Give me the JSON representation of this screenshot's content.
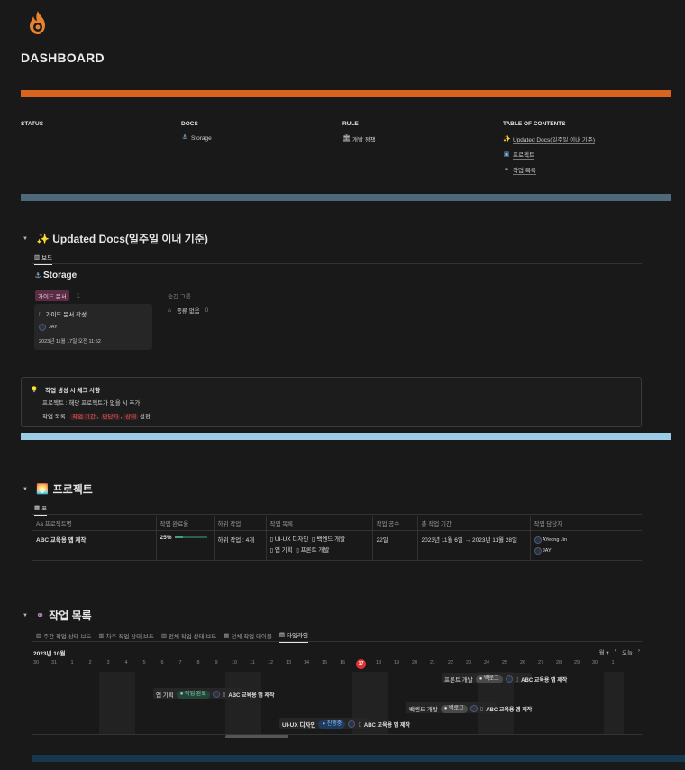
{
  "page": {
    "title": "DASHBOARD",
    "icon": "fire-icon"
  },
  "columns": {
    "status": {
      "heading": "STATUS"
    },
    "docs": {
      "heading": "DOCS",
      "items": [
        {
          "icon": "anchor-icon",
          "label": "Storage"
        }
      ]
    },
    "rule": {
      "heading": "RULE",
      "items": [
        {
          "icon": "building-icon",
          "label": "개발 정책"
        }
      ]
    },
    "toc": {
      "heading": "TABLE OF CONTENTS",
      "items": [
        {
          "icon": "sparkles-icon",
          "label": "Updated Docs(일주일 이내 기준)"
        },
        {
          "icon": "book-icon",
          "label": "프로젝트"
        },
        {
          "icon": "link-icon",
          "label": "작업 목록"
        }
      ]
    }
  },
  "updated_docs": {
    "title": "✨ Updated Docs(일주일 이내 기준)",
    "tab": "보드",
    "board_title": "Storage",
    "group_tag": "가이드 문서",
    "group_count": "1",
    "hidden_groups_label": "숨긴 그룹",
    "no_type_label": "종류 없음",
    "no_type_count": "0",
    "card": {
      "title": "가이드 문서 작성",
      "author": "JAY",
      "date": "2023년 11월 17일 오전 11:52"
    }
  },
  "callout": {
    "title": "작업 생성 시 체크 사항",
    "line1": "프로젝트 : 해당 프로젝트가 없을 시 추가",
    "line2_prefix": "작업 목록 : ",
    "tags": [
      "작업 기간",
      "담당자",
      "상태"
    ],
    "line2_suffix": " 설정"
  },
  "projects": {
    "title": "프로젝트",
    "tab": "표",
    "headers": [
      "Aa 프로젝트명",
      "작업 완료율",
      "하위 작업",
      "작업 목록",
      "작업 공수",
      "총 작업 기간",
      "작업 담당자"
    ],
    "row": {
      "name": "ABC 교육용 앱 제작",
      "progress_label": "25%",
      "progress": 0.25,
      "subtasks": "하위 작업 : 4개",
      "tasks": [
        "UI-UX 디자인",
        "백엔드 개발",
        "앱 기획",
        "프론트 개발"
      ],
      "effort": "22일",
      "period": "2023년 11월 6일 → 2023년 11월 28일",
      "assignees": [
        "AYeong Jin",
        "JAY"
      ]
    }
  },
  "tasks": {
    "title": "작업 목록",
    "tabs": [
      "주간 작업 상태 보드",
      "차주 작업 상태 보드",
      "전체 작업 상태 보드",
      "전체 작업 테이블",
      "타임라인"
    ],
    "active_tab": "타임라인",
    "month": "2023년 10월",
    "unit": "월",
    "today_label": "오늘",
    "days": [
      "30",
      "31",
      "1",
      "2",
      "3",
      "4",
      "5",
      "6",
      "7",
      "8",
      "9",
      "10",
      "11",
      "12",
      "13",
      "14",
      "15",
      "16",
      "17",
      "18",
      "19",
      "20",
      "21",
      "22",
      "23",
      "24",
      "25",
      "26",
      "27",
      "28",
      "29",
      "30",
      "1"
    ],
    "today": "17",
    "items": [
      {
        "name": "프론트 개발",
        "status": "백로그",
        "project": "ABC 교육용 앱 제작"
      },
      {
        "name": "앱 기획",
        "status": "작업 완료",
        "project": "ABC 교육용 앱 제작"
      },
      {
        "name": "백엔드 개발",
        "status": "백로그",
        "project": "ABC 교육용 앱 제작"
      },
      {
        "name": "UI-UX 디자인",
        "status": "진행중",
        "project": "ABC 교육용 앱 제작"
      }
    ]
  },
  "colors": {
    "accent_orange": "#d9641e",
    "slate": "#4e6a7a",
    "light_blue": "#9ccbe6",
    "navy": "#17374f",
    "today_red": "#dd3333"
  }
}
